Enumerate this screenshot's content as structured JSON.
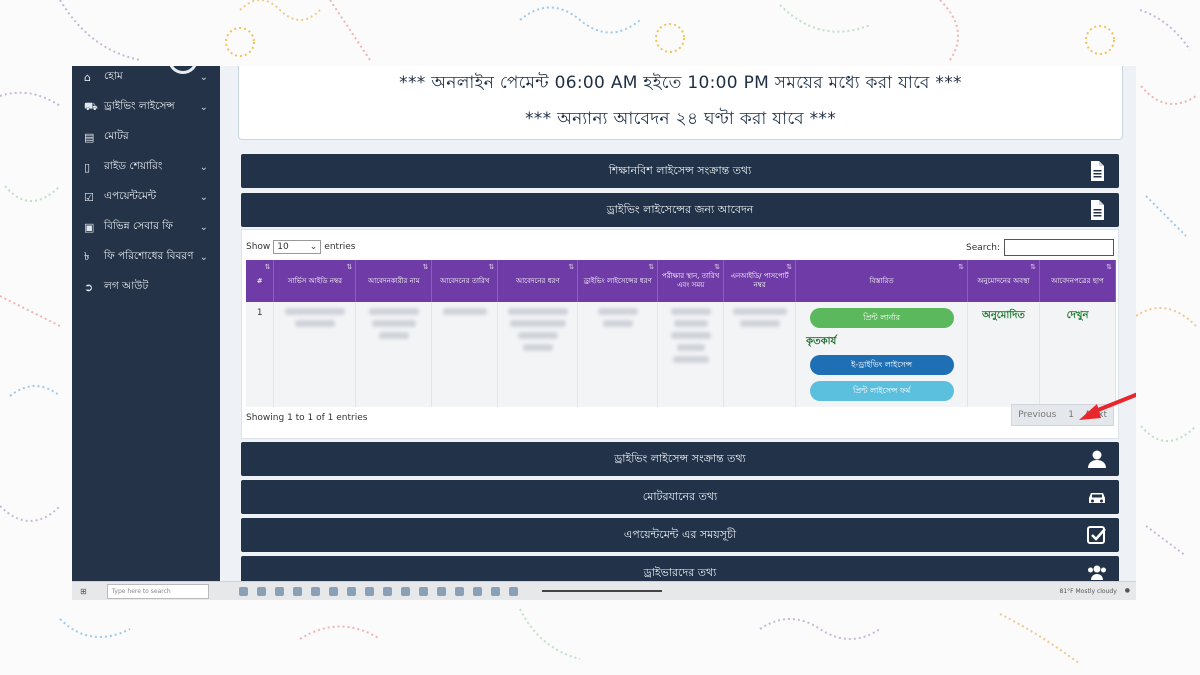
{
  "sidebar": {
    "items": [
      {
        "label": "হোম",
        "icon": "home-icon",
        "has_chevron": true
      },
      {
        "label": "ড্রাইভিং লাইসেন্স",
        "icon": "car-icon",
        "has_chevron": true
      },
      {
        "label": "মোটর",
        "icon": "book-icon",
        "has_chevron": false
      },
      {
        "label": "রাইড শেয়ারিং",
        "icon": "mobile-icon",
        "has_chevron": true
      },
      {
        "label": "এপয়েন্টমেন্ট",
        "icon": "check-square-icon",
        "has_chevron": true
      },
      {
        "label": "বিভিন্ন সেবার ফি",
        "icon": "money-icon",
        "has_chevron": true
      },
      {
        "label": "ফি পরিশোধের বিবরণ",
        "icon": "taka-icon",
        "has_chevron": true
      },
      {
        "label": "লগ আউট",
        "icon": "logout-icon",
        "has_chevron": false
      }
    ]
  },
  "notice": {
    "line1": "*** অনলাইন পেমেন্ট 06:00 AM হইতে 10:00 PM সময়ের মধ্যে করা যাবে ***",
    "line2": "*** অন্যান্য আবেদন ২৪ ঘণ্টা করা যাবে ***"
  },
  "panels": {
    "learner": {
      "label": "শিক্ষানবিশ লাইসেন্স সংক্রান্ত তথ্য",
      "icon": "document-icon"
    },
    "application": {
      "label": "ড্রাইভিং লাইসেন্সের জন্য আবেদন",
      "icon": "document-icon"
    },
    "license_info": {
      "label": "ড্রাইভিং লাইসেন্স সংক্রান্ত তথ্য",
      "icon": "user-icon"
    },
    "vehicle": {
      "label": "মোটরযানের তথ্য",
      "icon": "car-icon"
    },
    "appointment": {
      "label": "এপয়েন্টমেন্ট এর সময়সূচী",
      "icon": "check-square-icon"
    },
    "drivers": {
      "label": "ড্রাইভারদের তথ্য",
      "icon": "users-icon"
    }
  },
  "table": {
    "show_label": "Show",
    "entries_value": "10",
    "entries_label": "entries",
    "search_label": "Search:",
    "search_value": "",
    "headers": [
      "#",
      "সার্ভিস আইডি নম্বর",
      "আবেদনকারীর নাম",
      "আবেদনের তারিখ",
      "আবেদনের ধরণ",
      "ড্রাইভিং লাইসেন্সের ধরণ",
      "পরীক্ষার স্থান, তারিখ এবং সময়",
      "এনআইডি/ পাসপোর্ট নম্বর",
      "বিস্তারিত",
      "অনুমোদনের অবস্থা",
      "আবেদনপত্রের ছাপ"
    ],
    "row": {
      "index": "1",
      "print_learner_button": "প্রিন্ট লার্নার",
      "status_done": "কৃতকার্য",
      "e_license_button": "ই-ড্রাইভিং লাইসেন্স",
      "print_license_form_button": "প্রিন্ট লাইসেন্স ফর্ম",
      "approval_status": "অনুমোদিত",
      "view_link": "দেখুন"
    },
    "footer_info": "Showing 1 to 1 of 1 entries",
    "pager": {
      "previous": "Previous",
      "page": "1",
      "next": "Next"
    }
  },
  "taskbar": {
    "search_placeholder": "Type here to search",
    "weather": "81°F  Mostly cloudy"
  },
  "colors": {
    "sidebar_bg": "#243347",
    "panel_bg": "#223248",
    "table_header": "#6f3ba6",
    "green_button": "#5cb85c",
    "blue_button": "#1f6fb5",
    "light_blue_button": "#5bc0de",
    "approved_text": "#1b7a2a",
    "arrow": "#e8262b"
  }
}
